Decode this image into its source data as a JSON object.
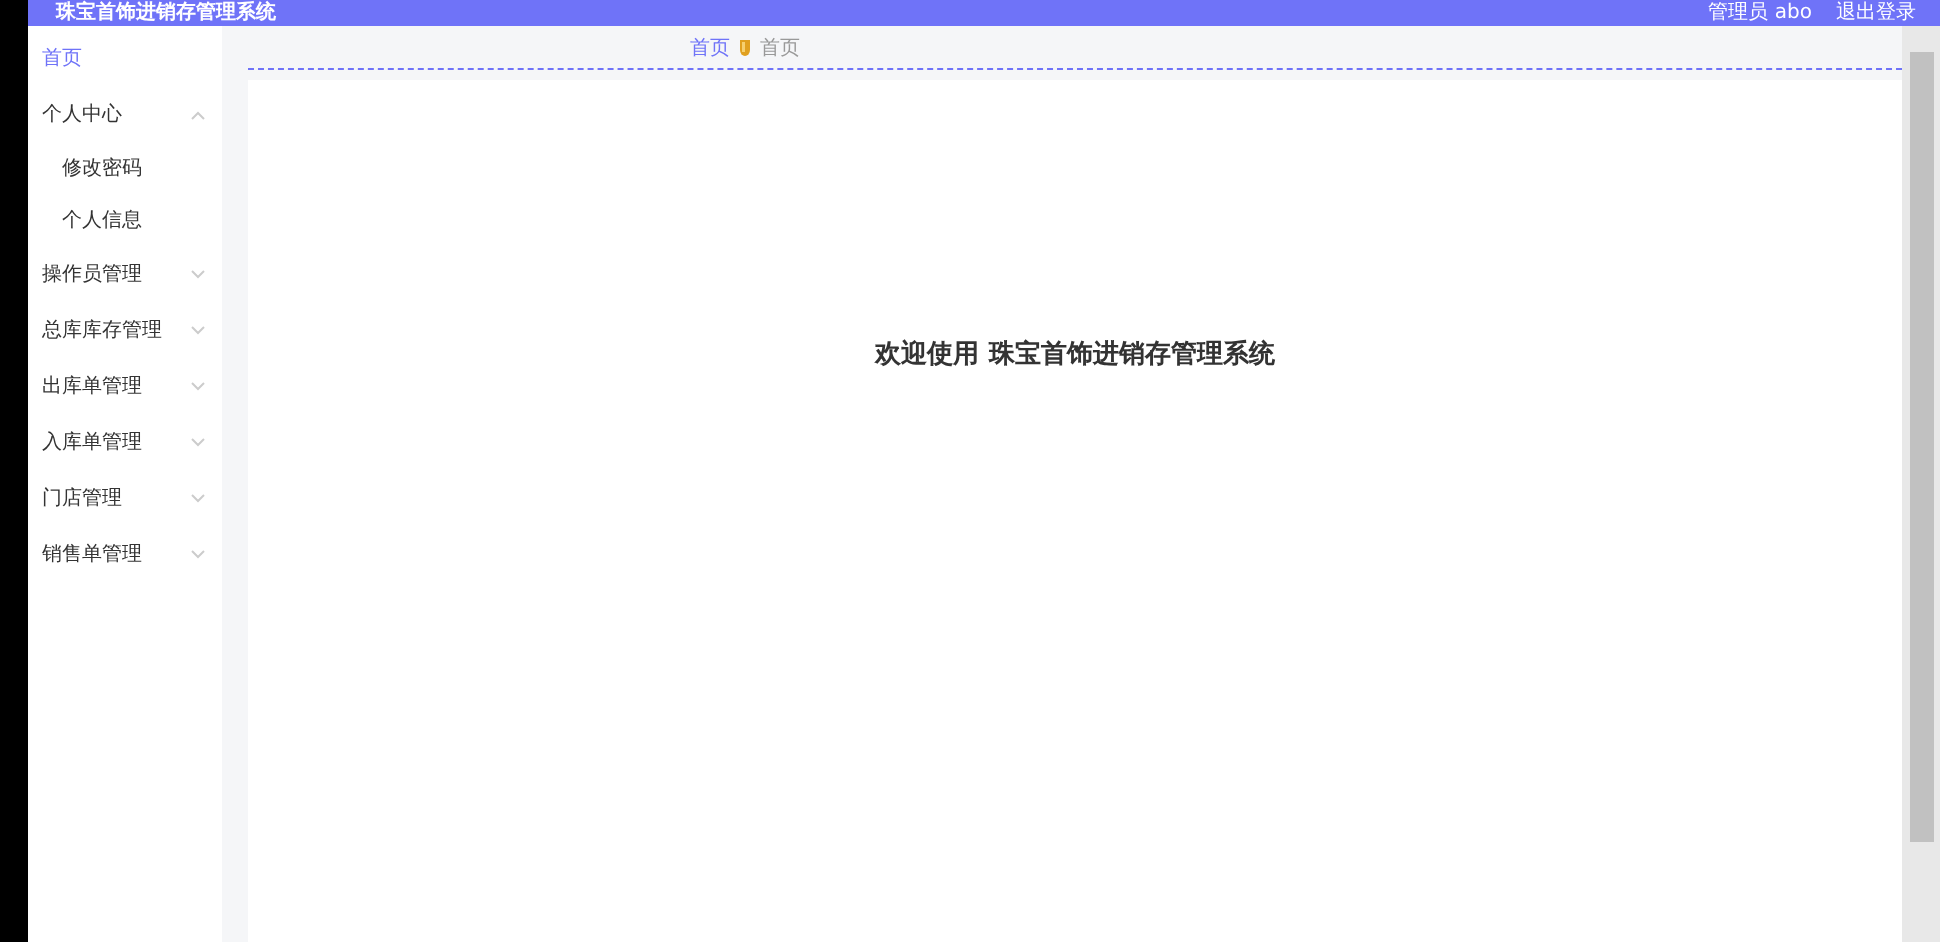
{
  "header": {
    "title": "珠宝首饰进销存管理系统",
    "user": "管理员 abo",
    "logout": "退出登录"
  },
  "sidebar": {
    "items": [
      {
        "label": "首页",
        "selected": true
      },
      {
        "label": "个人中心",
        "expanded": true,
        "selected": false,
        "children": [
          {
            "label": "修改密码",
            "selected": false
          },
          {
            "label": "个人信息",
            "selected": false
          }
        ]
      },
      {
        "label": "操作员管理",
        "expanded": false,
        "selected": false
      },
      {
        "label": "总库库存管理",
        "expanded": false,
        "selected": false
      },
      {
        "label": "出库单管理",
        "expanded": false,
        "selected": false
      },
      {
        "label": "入库单管理",
        "expanded": false,
        "selected": false
      },
      {
        "label": "门店管理",
        "expanded": false,
        "selected": false
      },
      {
        "label": "销售单管理",
        "expanded": false,
        "selected": false
      }
    ]
  },
  "breadcrumb": [
    {
      "label": "首页",
      "selected": true
    },
    {
      "label": "首页",
      "selected": false
    }
  ],
  "welcome": "欢迎使用 珠宝首饰进销存管理系统"
}
